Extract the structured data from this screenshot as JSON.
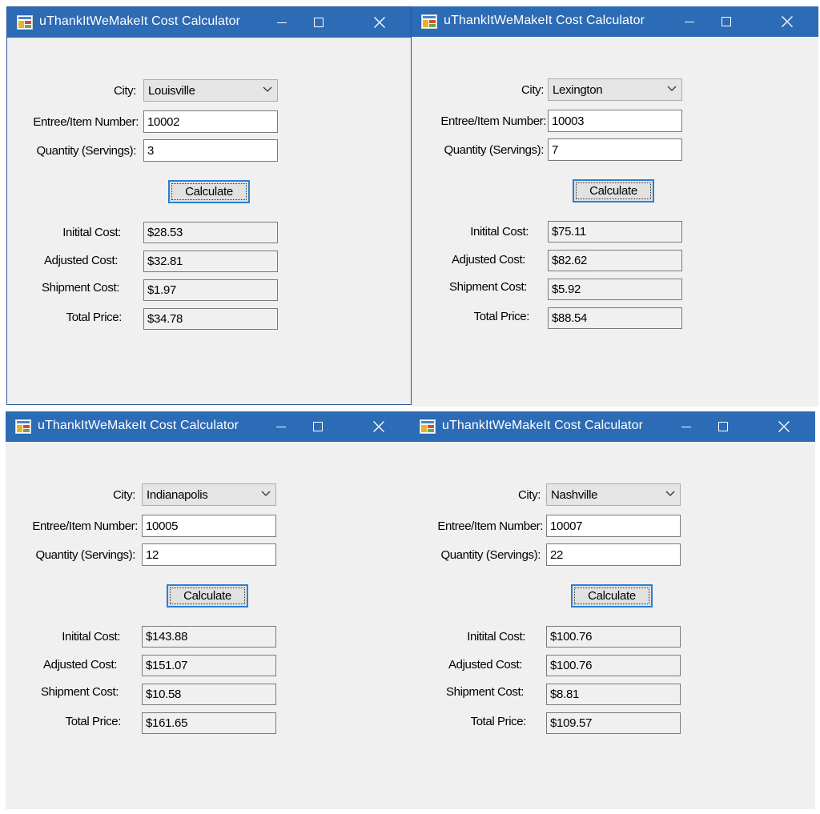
{
  "labels": {
    "city": "City:",
    "item": "Entree/Item Number:",
    "qty": "Quantity (Servings):",
    "calculate": "Calculate",
    "initial": "Initital Cost:",
    "adjusted": "Adjusted Cost:",
    "shipment": "Shipment Cost:",
    "total": "Total Price:"
  },
  "windows": [
    {
      "title": "uThankItWeMakeIt Cost Calculator",
      "city": "Louisville",
      "item": "10002",
      "qty": "3",
      "initial": "$28.53",
      "adjusted": "$32.81",
      "shipment": "$1.97",
      "total": "$34.78"
    },
    {
      "title": "uThankItWeMakeIt Cost Calculator",
      "city": "Lexington",
      "item": "10003",
      "qty": "7",
      "initial": "$75.11",
      "adjusted": "$82.62",
      "shipment": "$5.92",
      "total": "$88.54"
    },
    {
      "title": "uThankItWeMakeIt Cost Calculator",
      "city": "Indianapolis",
      "item": "10005",
      "qty": "12",
      "initial": "$143.88",
      "adjusted": "$151.07",
      "shipment": "$10.58",
      "total": "$161.65"
    },
    {
      "title": "uThankItWeMakeIt Cost Calculator",
      "city": "Nashville",
      "item": "10007",
      "qty": "22",
      "initial": "$100.76",
      "adjusted": "$100.76",
      "shipment": "$8.81",
      "total": "$109.57"
    }
  ],
  "colors": {
    "titlebar": "#2c6bb5",
    "window_bg": "#f0f0f0",
    "button_focus": "#2a7fd4"
  },
  "icons": {
    "app": "app-icon",
    "minimize": "minimize-icon",
    "maximize": "maximize-icon",
    "close": "close-icon",
    "dropdown": "chevron-down-icon"
  }
}
